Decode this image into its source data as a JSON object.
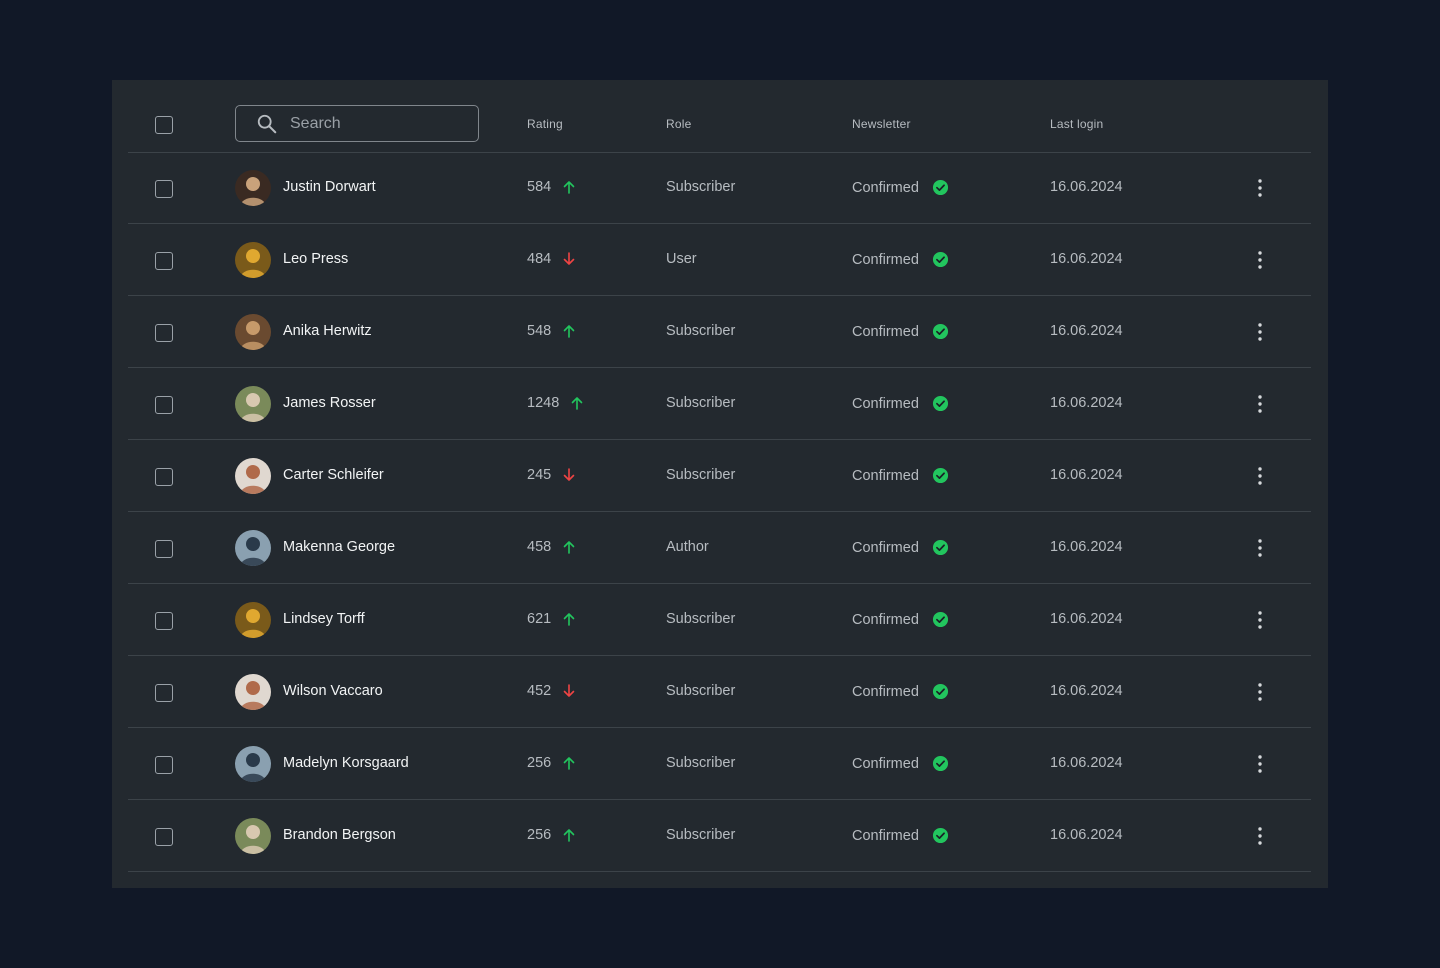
{
  "colors": {
    "background": "#111827",
    "panel": "#23292f",
    "divider": "#3c4349",
    "text_primary": "#f2f4f5",
    "text_secondary": "#b7bcc1",
    "trend_up": "#22c55e",
    "trend_down": "#ef4444",
    "confirmed": "#22c55e"
  },
  "search": {
    "placeholder": "Search",
    "icon": "search-icon"
  },
  "columns": {
    "rating": "Rating",
    "role": "Role",
    "newsletter": "Newsletter",
    "last_login": "Last login"
  },
  "rows": [
    {
      "name": "Justin Dorwart",
      "rating": "584",
      "trend": "up",
      "role": "Subscriber",
      "newsletter": "Confirmed",
      "last_login": "16.06.2024",
      "avatar_colors": [
        "#c9a27b",
        "#3a2a22"
      ]
    },
    {
      "name": "Leo Press",
      "rating": "484",
      "trend": "down",
      "role": "User",
      "newsletter": "Confirmed",
      "last_login": "16.06.2024",
      "avatar_colors": [
        "#e0a830",
        "#7a5a1a"
      ]
    },
    {
      "name": "Anika Herwitz",
      "rating": "548",
      "trend": "up",
      "role": "Subscriber",
      "newsletter": "Confirmed",
      "last_login": "16.06.2024",
      "avatar_colors": [
        "#c79a6a",
        "#6a4a30"
      ]
    },
    {
      "name": "James Rosser",
      "rating": "1248",
      "trend": "up",
      "role": "Subscriber",
      "newsletter": "Confirmed",
      "last_login": "16.06.2024",
      "avatar_colors": [
        "#d8c8b0",
        "#7a8a5a"
      ]
    },
    {
      "name": "Carter Schleifer",
      "rating": "245",
      "trend": "down",
      "role": "Subscriber",
      "newsletter": "Confirmed",
      "last_login": "16.06.2024",
      "avatar_colors": [
        "#b06a4a",
        "#e0d8d0"
      ]
    },
    {
      "name": "Makenna George",
      "rating": "458",
      "trend": "up",
      "role": "Author",
      "newsletter": "Confirmed",
      "last_login": "16.06.2024",
      "avatar_colors": [
        "#2a3a4a",
        "#8aa0b0"
      ]
    },
    {
      "name": "Lindsey Torff",
      "rating": "621",
      "trend": "up",
      "role": "Subscriber",
      "newsletter": "Confirmed",
      "last_login": "16.06.2024",
      "avatar_colors": [
        "#e0a830",
        "#7a5a1a"
      ]
    },
    {
      "name": "Wilson Vaccaro",
      "rating": "452",
      "trend": "down",
      "role": "Subscriber",
      "newsletter": "Confirmed",
      "last_login": "16.06.2024",
      "avatar_colors": [
        "#b06a4a",
        "#e0d8d0"
      ]
    },
    {
      "name": "Madelyn Korsgaard",
      "rating": "256",
      "trend": "up",
      "role": "Subscriber",
      "newsletter": "Confirmed",
      "last_login": "16.06.2024",
      "avatar_colors": [
        "#2a3a4a",
        "#8aa0b0"
      ]
    },
    {
      "name": "Brandon Bergson",
      "rating": "256",
      "trend": "up",
      "role": "Subscriber",
      "newsletter": "Confirmed",
      "last_login": "16.06.2024",
      "avatar_colors": [
        "#d8c8b0",
        "#7a8a5a"
      ]
    }
  ]
}
